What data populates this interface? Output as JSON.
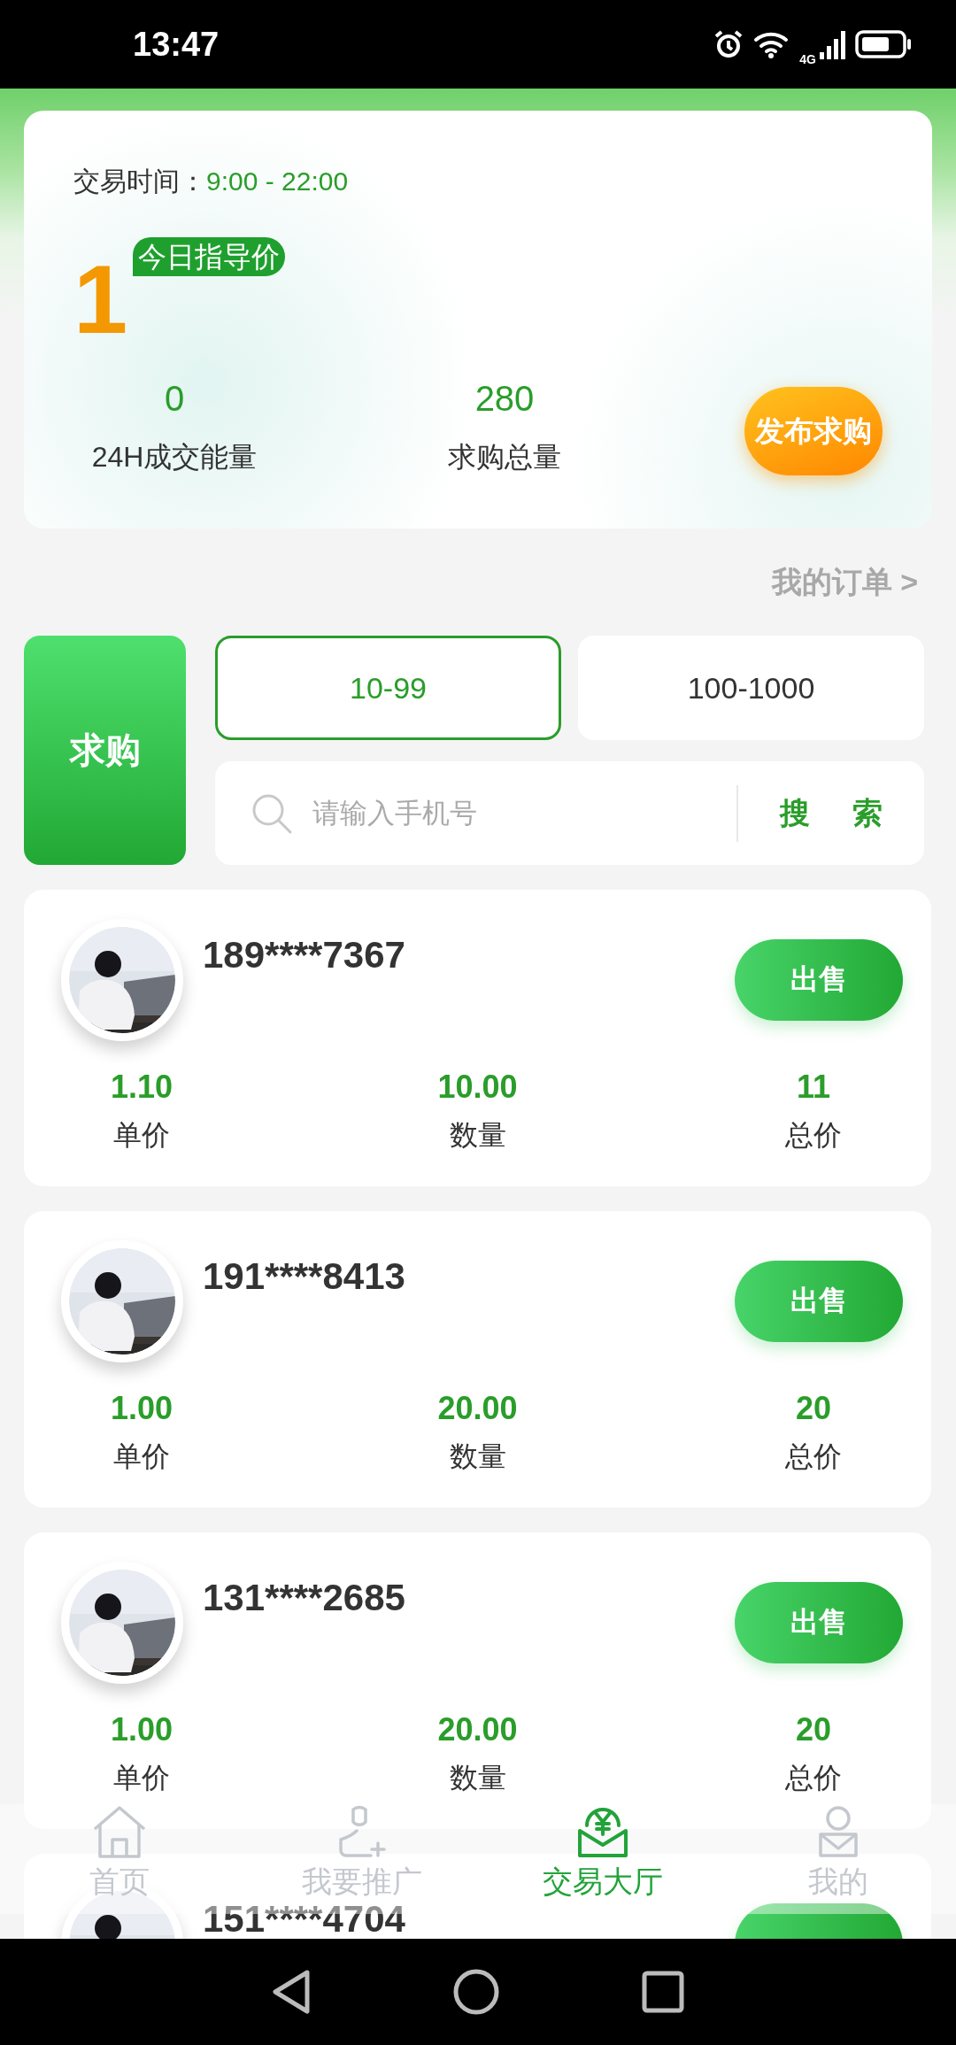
{
  "status_bar": {
    "time": "13:47",
    "network": "4G"
  },
  "summary": {
    "trade_time_label": "交易时间：",
    "trade_time": "9:00 - 22:00",
    "guide_price": "1",
    "guide_price_badge": "今日指导价",
    "stats": [
      {
        "value": "0",
        "label": "24H成交能量"
      },
      {
        "value": "280",
        "label": "求购总量"
      }
    ],
    "publish_button": "发布求购"
  },
  "my_orders_link": "我的订单 >",
  "buy_button": "求购",
  "ranges": [
    {
      "label": "10-99",
      "selected": true
    },
    {
      "label": "100-1000",
      "selected": false
    }
  ],
  "search": {
    "placeholder": "请输入手机号",
    "button": "搜 索"
  },
  "orders": [
    {
      "phone": "189****7367",
      "sell_label": "出售",
      "stats": [
        {
          "value": "1.10",
          "label": "单价"
        },
        {
          "value": "10.00",
          "label": "数量"
        },
        {
          "value": "11",
          "label": "总价"
        }
      ]
    },
    {
      "phone": "191****8413",
      "sell_label": "出售",
      "stats": [
        {
          "value": "1.00",
          "label": "单价"
        },
        {
          "value": "20.00",
          "label": "数量"
        },
        {
          "value": "20",
          "label": "总价"
        }
      ]
    },
    {
      "phone": "131****2685",
      "sell_label": "出售",
      "stats": [
        {
          "value": "1.00",
          "label": "单价"
        },
        {
          "value": "20.00",
          "label": "数量"
        },
        {
          "value": "20",
          "label": "总价"
        }
      ]
    },
    {
      "phone": "151****4704"
    }
  ],
  "bottom_nav": [
    {
      "label": "首页",
      "selected": false
    },
    {
      "label": "我要推广",
      "selected": false
    },
    {
      "label": "交易大厅",
      "selected": true
    },
    {
      "label": "我的",
      "selected": false
    }
  ]
}
